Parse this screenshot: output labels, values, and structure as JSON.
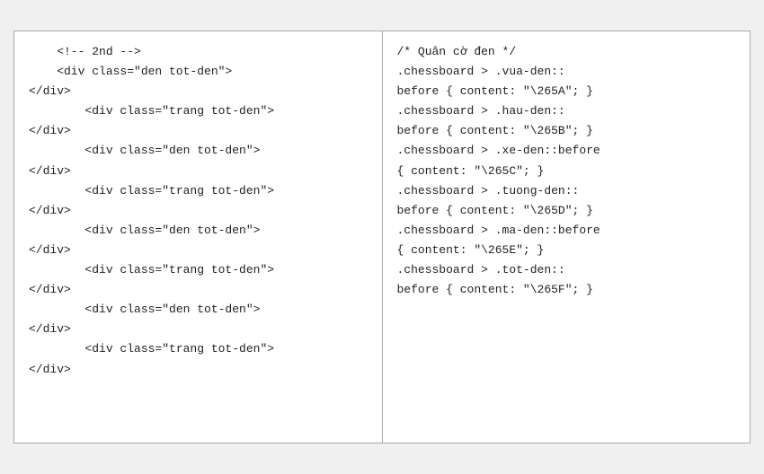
{
  "left": {
    "lines": [
      "    <!-- 2nd -->",
      "    <div class=\"den tot-den\">",
      "</div>",
      "        <div class=\"trang tot-den\">",
      "</div>",
      "        <div class=\"den tot-den\">",
      "</div>",
      "        <div class=\"trang tot-den\">",
      "</div>",
      "        <div class=\"den tot-den\">",
      "</div>",
      "        <div class=\"trang tot-den\">",
      "</div>",
      "        <div class=\"den tot-den\">",
      "</div>",
      "        <div class=\"trang tot-den\">",
      "</div>"
    ]
  },
  "right": {
    "lines": [
      "/* Quân cờ đen */",
      ".chessboard > .vua-den::",
      "before { content: \"\\265A\"; }",
      ".chessboard > .hau-den::",
      "before { content: \"\\265B\"; }",
      ".chessboard > .xe-den::before",
      "{ content: \"\\265C\"; }",
      ".chessboard > .tuong-den::",
      "before { content: \"\\265D\"; }",
      ".chessboard > .ma-den::before",
      "{ content: \"\\265E\"; }",
      ".chessboard > .tot-den::",
      "before { content: \"\\265F\"; }"
    ]
  }
}
